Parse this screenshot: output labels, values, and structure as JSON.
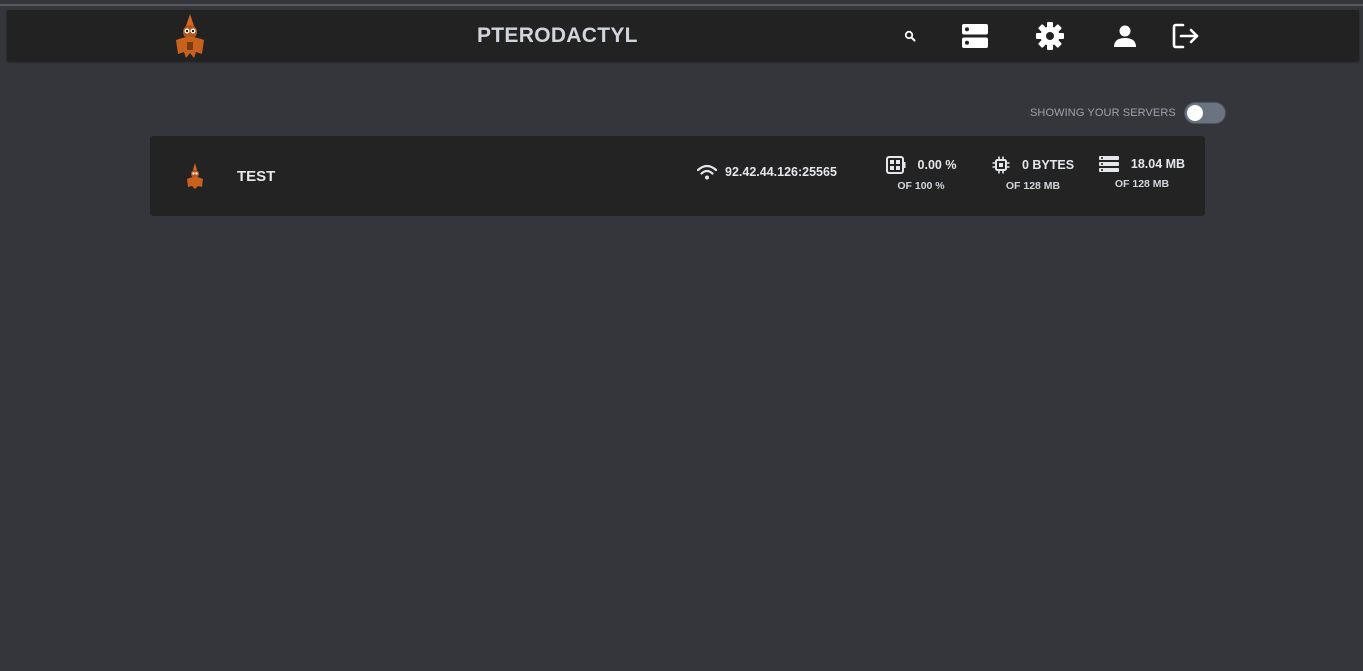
{
  "navbar": {
    "brand": "PTERODACTYL",
    "icons": [
      "search-icon",
      "servers-icon",
      "settings-icon",
      "account-icon",
      "logout-icon"
    ]
  },
  "filter": {
    "label": "SHOWING YOUR SERVERS",
    "toggle_on": false
  },
  "servers": [
    {
      "name": "TEST",
      "address": "92.42.44.126:25565",
      "cpu": {
        "value": "0.00 %",
        "limit": "OF 100 %"
      },
      "memory": {
        "value": "0 BYTES",
        "limit": "OF 128 MB"
      },
      "disk": {
        "value": "18.04 MB",
        "limit": "OF 128 MB"
      }
    }
  ],
  "colors": {
    "background": "#35363b",
    "navbar": "#222222",
    "card": "#232323",
    "logo_orange": "#c8611e"
  }
}
